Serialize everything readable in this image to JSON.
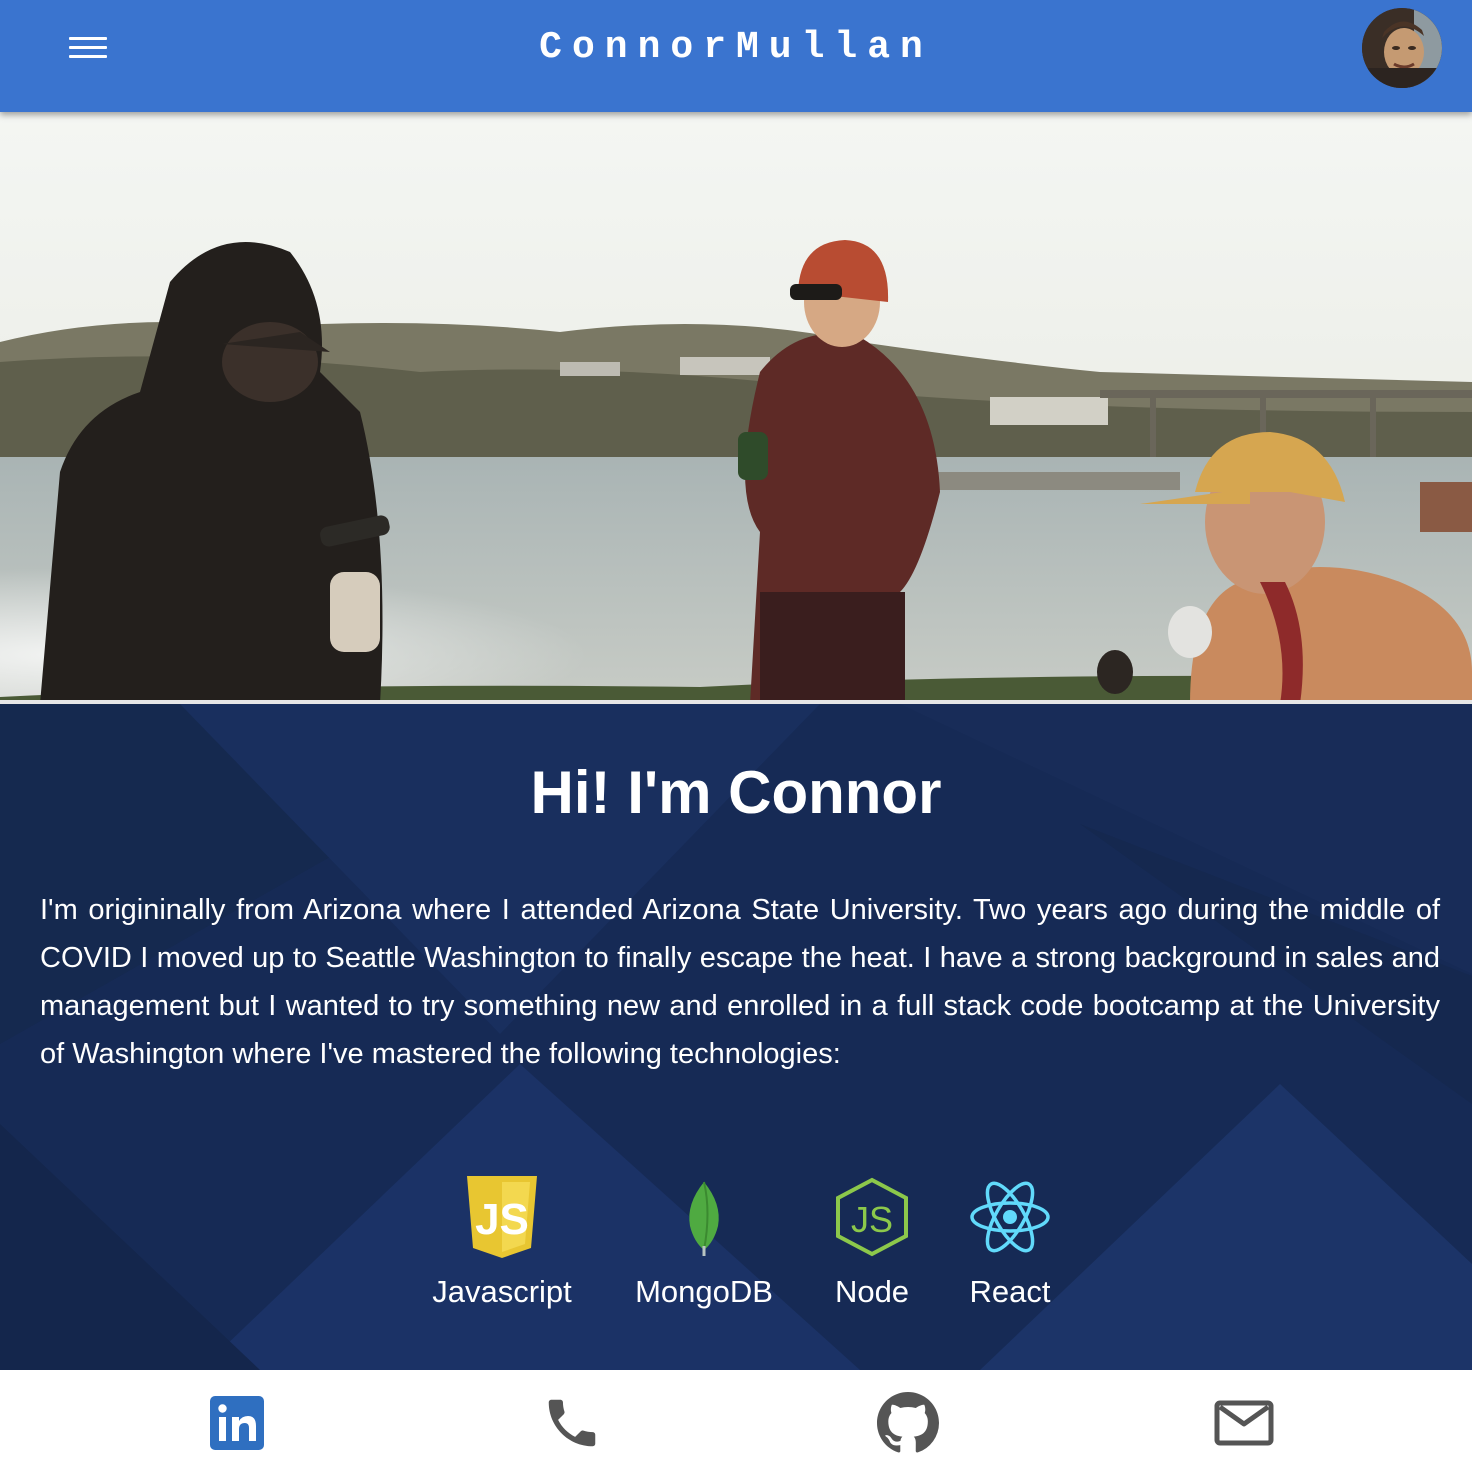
{
  "header": {
    "title": "ConnorMullan",
    "menu_icon": "menu-icon",
    "avatar_icon": "profile-avatar",
    "background_color": "#3a74cf"
  },
  "about": {
    "heading": "Hi! I'm Connor",
    "bio": "I'm origininally from Arizona where I attended Arizona State University. Two years ago during the middle of COVID I moved up to Seattle Washington to finally escape the heat. I have a strong background in sales and management but I wanted to try something new and enrolled in a full stack code bootcamp at the University of Washington where I've mastered the following technologies:",
    "background_color": "#172a55",
    "technologies": [
      {
        "label": "Javascript",
        "icon": "javascript-icon",
        "color": "#f0db4f"
      },
      {
        "label": "MongoDB",
        "icon": "mongodb-leaf-icon",
        "color": "#4faa41"
      },
      {
        "label": "Node",
        "icon": "nodejs-icon",
        "color": "#8cc84b"
      },
      {
        "label": "React",
        "icon": "react-icon",
        "color": "#61dafb"
      }
    ]
  },
  "footer": {
    "links": [
      {
        "icon": "linkedin-icon",
        "color": "#2f6fc0"
      },
      {
        "icon": "phone-icon",
        "color": "#555555"
      },
      {
        "icon": "github-icon",
        "color": "#555555"
      },
      {
        "icon": "mail-icon",
        "color": "#555555"
      }
    ]
  }
}
